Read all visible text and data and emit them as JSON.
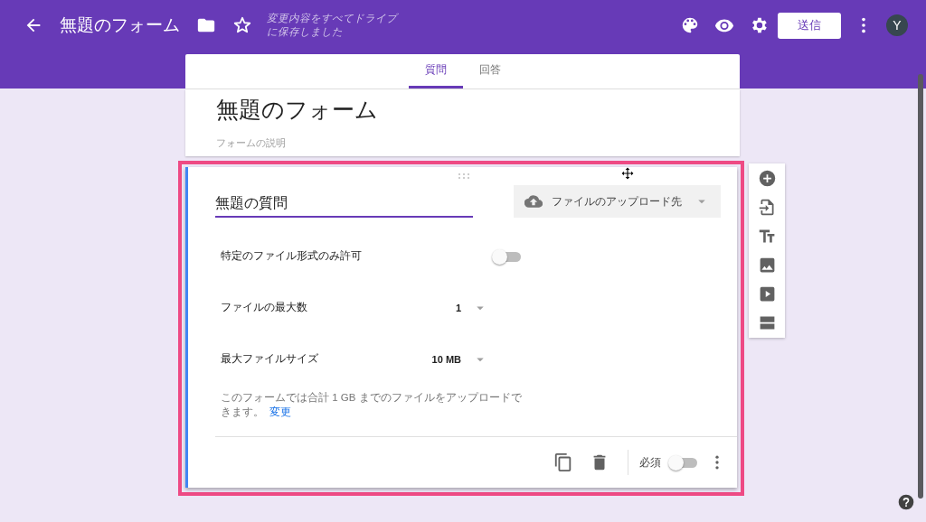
{
  "header": {
    "title": "無題のフォーム",
    "save_status": "変更内容をすべてドライブに保存しました",
    "send_button": "送信",
    "avatar": "Y"
  },
  "tabs": [
    {
      "label": "質問",
      "selected": true
    },
    {
      "label": "回答",
      "selected": false
    }
  ],
  "form": {
    "title": "無題のフォーム",
    "description_placeholder": "フォームの説明"
  },
  "question": {
    "title": "無題の質問",
    "type": "ファイルのアップロード先",
    "settings": [
      {
        "kind": "toggle",
        "label": "特定のファイル形式のみ許可",
        "on": false
      },
      {
        "kind": "select",
        "label": "ファイルの最大数",
        "value": "1"
      },
      {
        "kind": "select",
        "label": "最大ファイルサイズ",
        "value": "10 MB"
      }
    ],
    "note": "このフォームでは合計 1 GB までのファイルをアップロードできます。",
    "note_link": "変更",
    "required_label": "必須",
    "required": false
  }
}
